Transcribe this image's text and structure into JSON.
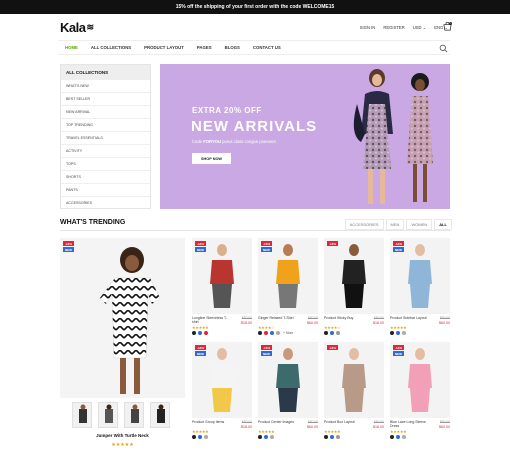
{
  "topbar": {
    "message": "15% off the shipping of your first order with the code WELCOME15"
  },
  "header": {
    "logo": "Kala",
    "links": [
      "SIGN IN",
      "REGISTER",
      "USD ⌄",
      "ENG ⌄"
    ],
    "cart_count": "0"
  },
  "nav": {
    "items": [
      "HOME",
      "ALL COLLECTIONS",
      "PRODUCT LAYOUT",
      "PAGES",
      "BLOGS",
      "CONTACT US"
    ]
  },
  "categories": {
    "title": "ALL COLLECTIONS",
    "items": [
      "WHAT'S NEW",
      "BEST SELLER",
      "NEW ARRIVAL",
      "TOP TRENDING",
      "TRAVEL ESSENTIALS",
      "ACTIVITY",
      "TOPS",
      "SHORTS",
      "PANTS",
      "ACCESSORIES"
    ]
  },
  "hero": {
    "extra": "EXTRA 20% OFF",
    "title": "NEW ARRIVALS",
    "code_prefix": "Code",
    "code": "FORYOU",
    "code_suffix": "purus class congue praesent.",
    "button": "SHOP NOW",
    "bg_color": "#c9a8e3"
  },
  "trending": {
    "title": "WHAT'S TRENDING",
    "tabs": [
      "ACCESSORIES",
      "MEN",
      "WOMEN",
      "ALL"
    ]
  },
  "featured": {
    "name": "Jumper With Turtle Neck",
    "stars": "★★★★★"
  },
  "products": [
    {
      "name": "Longline Sleeveless T-shirt",
      "old": "$50.00",
      "price": "$18.00",
      "stars": "★★★★★",
      "sale": "-13%",
      "new": "NEW",
      "swatches": [
        "#222",
        "#2e6bd9",
        "#e3253c"
      ],
      "more": ""
    },
    {
      "name": "Ginger Relaxed T-Shirt",
      "old": "$60.00",
      "price": "$60.00",
      "stars": "★★★★☆",
      "sale": "-13%",
      "new": "NEW",
      "swatches": [
        "#222",
        "#e3253c",
        "#2e6bd9",
        "#aaa"
      ],
      "more": "+ More"
    },
    {
      "name": "Product Sticky Buy",
      "old": "$50.00",
      "price": "$18.00",
      "stars": "★★★★☆",
      "sale": "-13%",
      "new": "",
      "swatches": [
        "#222",
        "#2e6bd9",
        "#999"
      ],
      "more": ""
    },
    {
      "name": "Product Sidebar Layout",
      "old": "$50.00",
      "price": "$60.00",
      "stars": "★★★★★",
      "sale": "-13%",
      "new": "NEW",
      "swatches": [
        "#222",
        "#2e6bd9",
        "#aaa"
      ],
      "more": ""
    },
    {
      "name": "Product Group Items",
      "old": "$50.00",
      "price": "$18.00",
      "stars": "★★★★★",
      "sale": "-13%",
      "new": "NEW",
      "swatches": [
        "#222",
        "#2e6bd9",
        "#aaa"
      ],
      "more": ""
    },
    {
      "name": "Product Center Images",
      "old": "$50.00",
      "price": "$60.00",
      "stars": "★★★★★",
      "sale": "-13%",
      "new": "NEW",
      "swatches": [
        "#222",
        "#2e6bd9",
        "#aaa"
      ],
      "more": ""
    },
    {
      "name": "Product Box Layout",
      "old": "$50.00",
      "price": "$18.00",
      "stars": "★★★★★",
      "sale": "-13%",
      "new": "",
      "swatches": [
        "#222",
        "#2e6bd9",
        "#999"
      ],
      "more": ""
    },
    {
      "name": "Blue Lace Long Sleeve Dress",
      "old": "$50.00",
      "price": "$60.00",
      "stars": "★★★★★",
      "sale": "-13%",
      "new": "NEW",
      "swatches": [
        "#222",
        "#2e6bd9",
        "#aaa"
      ],
      "more": ""
    }
  ],
  "colors": {
    "accent": "#58a700",
    "sale": "#e3253c",
    "new": "#2e6bd9",
    "star": "#e8a200"
  }
}
